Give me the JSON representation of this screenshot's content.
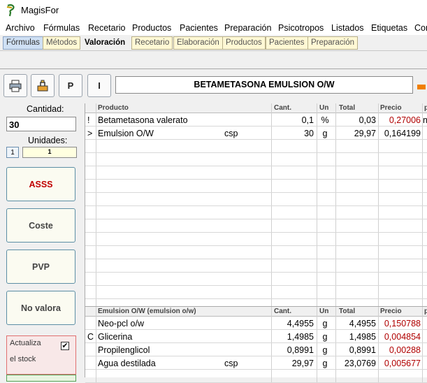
{
  "app": {
    "title": "MagisFor"
  },
  "menu": [
    "Archivo",
    "Fórmulas",
    "Recetario",
    "Productos",
    "Pacientes",
    "Preparación",
    "Psicotropos",
    "Listados",
    "Etiquetas",
    "Cor"
  ],
  "tabs": [
    "Fórmulas",
    "Métodos",
    "Valoración",
    "Recetario",
    "Elaboración",
    "Productos",
    "Pacientes",
    "Preparación"
  ],
  "toolbar": {
    "btn_p": "P",
    "btn_i": "I"
  },
  "formula_name": "BETAMETASONA EMULSION O/W",
  "left": {
    "cantidad_label": "Cantidad:",
    "cantidad_value": "30",
    "unidades_label": "Unidades:",
    "unidades_small": "1",
    "unidades_value": "1",
    "btn_asss": "ASSS",
    "btn_coste": "Coste",
    "btn_pvp": "PVP",
    "btn_novalora": "No valora",
    "stock_line1": "Actualiza",
    "stock_line2": "el stock",
    "stock_check": "✔"
  },
  "grid1": {
    "headers": {
      "producto": "Producto",
      "cant": "Cant.",
      "un": "Un",
      "total": "Total",
      "precio": "Precio",
      "p": "p"
    },
    "rows": [
      {
        "mark": "!",
        "producto": "Betametasona valerato",
        "extra": "",
        "cant": "0,1",
        "un": "%",
        "total": "0,03",
        "precio": "0,27006",
        "p": "n"
      },
      {
        "mark": ">",
        "producto": "Emulsion O/W",
        "extra": "csp",
        "cant": "30",
        "un": "g",
        "total": "29,97",
        "precio": "0,164199",
        "p": ""
      }
    ]
  },
  "grid2": {
    "headers": {
      "producto": "Emulsion O/W (emulsion o/w)",
      "cant": "Cant.",
      "un": "Un",
      "total": "Total",
      "precio": "Precio",
      "p": "p"
    },
    "rows": [
      {
        "mark": "",
        "producto": "Neo-pcl o/w",
        "extra": "",
        "cant": "4,4955",
        "un": "g",
        "total": "4,4955",
        "precio": "0,150788"
      },
      {
        "mark": "C",
        "producto": "Glicerina",
        "extra": "",
        "cant": "1,4985",
        "un": "g",
        "total": "1,4985",
        "precio": "0,004854"
      },
      {
        "mark": "",
        "producto": "Propilenglicol",
        "extra": "",
        "cant": "0,8991",
        "un": "g",
        "total": "0,8991",
        "precio": "0,00288"
      },
      {
        "mark": "",
        "producto": "Agua destilada",
        "extra": "csp",
        "cant": "29,97",
        "un": "g",
        "total": "23,0769",
        "precio": "0,005677"
      }
    ]
  },
  "colors": {
    "price_red": "#b00000",
    "accent_orange": "#f07f00",
    "tab_yellow": "#fff8d4"
  }
}
